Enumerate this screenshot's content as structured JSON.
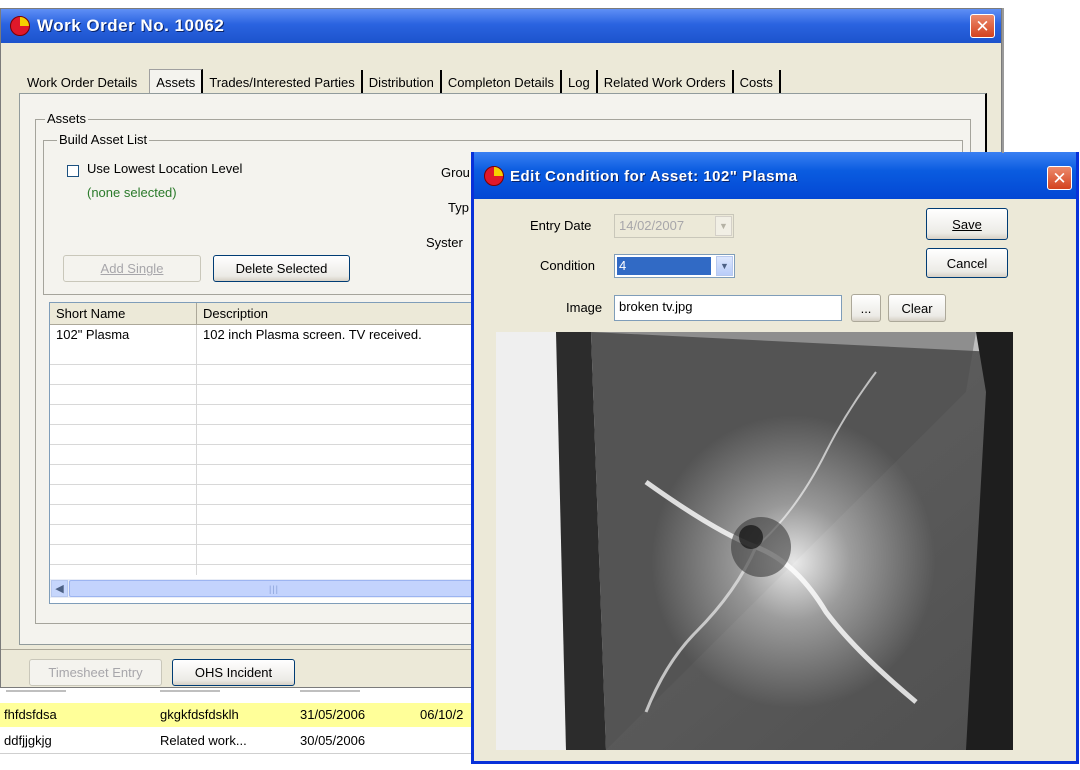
{
  "main_window": {
    "title": "Work Order No. 10062",
    "tabs": [
      "Work Order Details",
      "Assets",
      "Trades/Interested Parties",
      "Distribution",
      "Completon Details",
      "Log",
      "Related Work Orders",
      "Costs"
    ],
    "active_tab": "Assets",
    "assets_group_label": "Assets",
    "build_group_label": "Build Asset List",
    "use_lowest_label": "Use Lowest Location Level",
    "none_selected": "(none selected)",
    "group_label": "Grou",
    "type_label": "Typ",
    "system_label": "Syster",
    "add_single_label": "Add Single",
    "delete_selected_label": "Delete Selected",
    "grid": {
      "columns": [
        "Short Name",
        "Description"
      ],
      "rows": [
        {
          "short_name": "102\" Plasma",
          "description": "102 inch Plasma screen.  TV received."
        }
      ]
    },
    "timesheet_label": "Timesheet Entry",
    "ohs_label": "OHS Incident"
  },
  "background_list": {
    "rows": [
      {
        "c1": "fhfdsfdsa",
        "c2": "gkgkfdsfdsklh",
        "c3": "31/05/2006",
        "c4": "06/10/2",
        "highlight": true
      },
      {
        "c1": "ddfjjgkjg",
        "c2": "Related work...",
        "c3": "30/05/2006",
        "c4": "",
        "highlight": false
      }
    ],
    "highlight_color": "#ffff99"
  },
  "dialog": {
    "title": "Edit Condition for Asset: 102\" Plasma",
    "entry_date_label": "Entry Date",
    "entry_date_value": "14/02/2007",
    "condition_label": "Condition",
    "condition_value": "4",
    "image_label": "Image",
    "image_value": "broken tv.jpg",
    "browse_label": "...",
    "clear_label": "Clear",
    "save_label": "Save",
    "cancel_label": "Cancel"
  },
  "colors": {
    "title_bar": "#2a63e0",
    "dialog_frame": "#0831d9",
    "window_face": "#ece9d8",
    "green_text": "#2a7a2a",
    "selection": "#316ac5"
  }
}
